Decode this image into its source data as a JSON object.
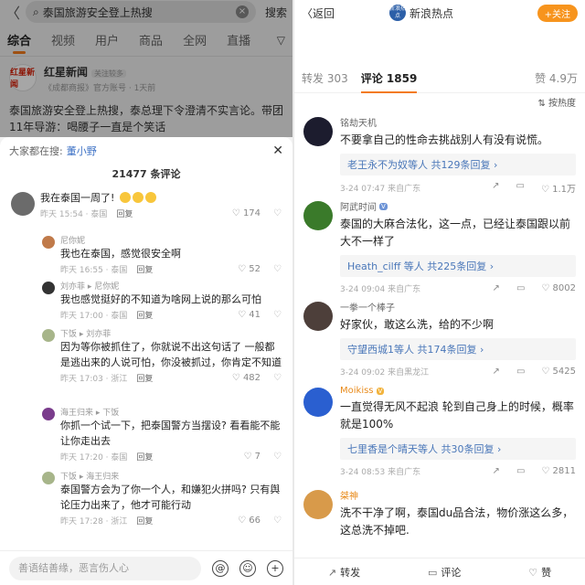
{
  "left": {
    "search": {
      "query": "泰国旅游安全登上热搜",
      "button": "搜索",
      "back": "〈"
    },
    "tabs": [
      "综合",
      "视频",
      "用户",
      "商品",
      "全网",
      "直播"
    ],
    "post": {
      "avatar_text": "红星新闻",
      "author": "红星新闻",
      "badge": "关注较多",
      "sub": "《成都商报》官方账号 · 1天前",
      "text": "泰国旅游安全登上热搜，泰总理下令澄清不实言论。带团11年导游：喝腰子一直是个笑话"
    },
    "sheet": {
      "searching_label": "大家都在搜:",
      "searching_term": "董小野",
      "count": "21477 条评论",
      "comments": [
        {
          "name": "",
          "text": "我在泰国一周了!",
          "meta": "昨天 15:54 · 泰国",
          "reply": "回复",
          "likes": "174"
        },
        {
          "name": "尼你妮",
          "text": "我也在泰国，感觉很安全啊",
          "meta": "昨天 16:55 · 泰国",
          "reply": "回复",
          "likes": "52"
        },
        {
          "name": "刘亦菲 ▸ 尼你妮",
          "text": "我也感觉挺好的不知道为啥网上说的那么可怕",
          "meta": "昨天 17:00 · 泰国",
          "reply": "回复",
          "likes": "41"
        },
        {
          "name": "下饭 ▸ 刘亦菲",
          "text": "因为等你被抓住了，你就说不出这句话了 一般都是逃出来的人说可怕，你没被抓过，你肯定不知道",
          "meta": "昨天 17:03 · 浙江",
          "reply": "回复",
          "likes": "482"
        },
        {
          "name": "海王归来 ▸ 下饭",
          "text": "你抓一个试一下，把泰国警方当摆设? 看看能不能让你走出去",
          "meta": "昨天 17:20 · 泰国",
          "reply": "回复",
          "likes": "7"
        },
        {
          "name": "下饭 ▸ 海王归来",
          "text": "泰国警方会为了你一个人，和嫌犯火拼吗? 只有舆论压力出来了，他才可能行动",
          "meta": "昨天 17:28 · 浙江",
          "reply": "回复",
          "likes": "66"
        }
      ],
      "input_placeholder": "善语结善缘，恶言伤人心"
    }
  },
  "right": {
    "back": "〈返回",
    "title": "新浪热点",
    "logo_text": "新浪热点",
    "follow": "+关注",
    "tabs": {
      "repost": "转发 303",
      "comment": "评论 1859",
      "likes": "赞 4.9万"
    },
    "sort": "⇅ 按热度",
    "comments": [
      {
        "name": "铭劫天机",
        "text": "不要拿自己的性命去挑战别人有没有说慌。",
        "sub": "老王永不为奴等人  共129条回复 ›",
        "meta": "3-24 07:47 来自广东",
        "likes": "1.1万",
        "avatar_color": "#1c1c2e"
      },
      {
        "name": "阿武时间",
        "text": "泰国的大麻合法化，这一点，已经让泰国跟以前大不一样了",
        "sub": "Heath_cilff 等人  共225条回复 ›",
        "meta": "3-24 09:04 来自广东",
        "likes": "8002",
        "avatar_color": "#3a7a2a"
      },
      {
        "name": "一拳一个棒子",
        "text": "好家伙，敢这么洗，给的不少啊",
        "sub": "守望西城1等人  共174条回复 ›",
        "meta": "3-24 09:02 来自黑龙江",
        "likes": "5425",
        "avatar_color": "#4d3f3a"
      },
      {
        "name": "Moikiss",
        "text": "一直觉得无风不起浪 轮到自己身上的时候，概率就是100%",
        "sub": "七里香是个晴天等人  共30条回复 ›",
        "meta": "3-24 08:53 来自广东",
        "likes": "2811",
        "avatar_color": "#2a5fd0"
      },
      {
        "name": "桀神",
        "text": "洗不干净了啊，泰国du品合法，物价涨这么多，这总洗不掉吧.",
        "sub": "",
        "meta": "",
        "likes": "",
        "avatar_color": "#d89a4a"
      }
    ],
    "bottom": {
      "repost": "转发",
      "comment": "评论",
      "like": "赞"
    }
  }
}
